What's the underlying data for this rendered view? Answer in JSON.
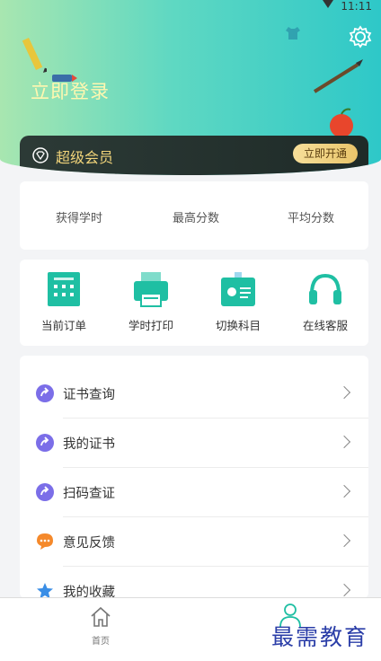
{
  "status": {
    "time": "11:11"
  },
  "header": {
    "login_text": "立即登录",
    "settings_icon": "gear-icon"
  },
  "vip": {
    "label": "超级会员",
    "button": "立即开通",
    "icon": "diamond-icon"
  },
  "stats": [
    "获得学时",
    "最高分数",
    "平均分数"
  ],
  "quick": [
    {
      "label": "当前订单",
      "icon": "order-icon"
    },
    {
      "label": "学时打印",
      "icon": "printer-icon"
    },
    {
      "label": "切换科目",
      "icon": "id-card-icon"
    },
    {
      "label": "在线客服",
      "icon": "headset-icon"
    }
  ],
  "menu": [
    {
      "label": "证书查询",
      "icon": "arrow-circle-icon"
    },
    {
      "label": "我的证书",
      "icon": "arrow-circle-icon"
    },
    {
      "label": "扫码查证",
      "icon": "arrow-circle-icon"
    },
    {
      "label": "意见反馈",
      "icon": "chat-bubble-icon"
    },
    {
      "label": "我的收藏",
      "icon": "star-icon"
    }
  ],
  "tabbar": {
    "home": "首页"
  },
  "watermark": "最需教育",
  "colors": {
    "header_start": "#a8e6b0",
    "header_end": "#2ec8c8",
    "vip_gold": "#f1d47a",
    "purple": "#7b6ee8",
    "orange": "#f5892b",
    "blue_star": "#3a8ee6"
  }
}
